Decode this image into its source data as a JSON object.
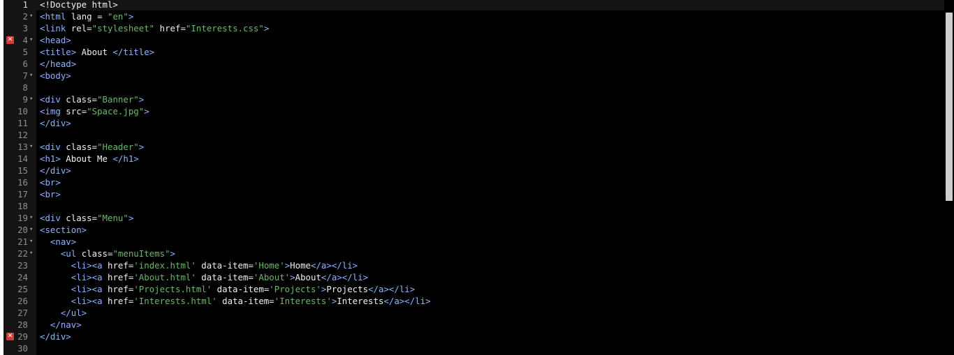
{
  "editor": {
    "colors": {
      "background": "#000000",
      "gutter": "#141414",
      "tag": "#8cb4ff",
      "string": "#68b868",
      "text": "#f0f0f0",
      "line_number": "#8f8f8f",
      "error_marker": "#d83a3a"
    },
    "lines": [
      {
        "n": "1",
        "fold": false,
        "error": false,
        "tokens": [
          {
            "t": "doctype",
            "v": "<!Doctype html>"
          }
        ]
      },
      {
        "n": "2",
        "fold": true,
        "error": false,
        "tokens": [
          {
            "t": "tag",
            "v": "<html"
          },
          {
            "t": "attr",
            "v": " lang "
          },
          {
            "t": "punc",
            "v": "= "
          },
          {
            "t": "str",
            "v": "\"en\""
          },
          {
            "t": "tag",
            "v": ">"
          }
        ]
      },
      {
        "n": "3",
        "fold": false,
        "error": false,
        "tokens": [
          {
            "t": "tag",
            "v": "<link"
          },
          {
            "t": "attr",
            "v": " rel"
          },
          {
            "t": "punc",
            "v": "="
          },
          {
            "t": "str",
            "v": "\"stylesheet\""
          },
          {
            "t": "attr",
            "v": " href"
          },
          {
            "t": "punc",
            "v": "="
          },
          {
            "t": "str",
            "v": "\"Interests.css\""
          },
          {
            "t": "tag",
            "v": ">"
          }
        ]
      },
      {
        "n": "4",
        "fold": true,
        "error": true,
        "tokens": [
          {
            "t": "tag",
            "v": "<head>"
          }
        ]
      },
      {
        "n": "5",
        "fold": false,
        "error": false,
        "tokens": [
          {
            "t": "tag",
            "v": "<title>"
          },
          {
            "t": "text",
            "v": " About "
          },
          {
            "t": "tag",
            "v": "</title>"
          }
        ]
      },
      {
        "n": "6",
        "fold": false,
        "error": false,
        "tokens": [
          {
            "t": "tag",
            "v": "</head>"
          }
        ]
      },
      {
        "n": "7",
        "fold": true,
        "error": false,
        "tokens": [
          {
            "t": "tag",
            "v": "<body>"
          }
        ]
      },
      {
        "n": "8",
        "fold": false,
        "error": false,
        "tokens": []
      },
      {
        "n": "9",
        "fold": true,
        "error": false,
        "tokens": [
          {
            "t": "tag",
            "v": "<div"
          },
          {
            "t": "attr",
            "v": " class"
          },
          {
            "t": "punc",
            "v": "="
          },
          {
            "t": "str",
            "v": "\"Banner\""
          },
          {
            "t": "tag",
            "v": ">"
          }
        ]
      },
      {
        "n": "10",
        "fold": false,
        "error": false,
        "tokens": [
          {
            "t": "tag",
            "v": "<img"
          },
          {
            "t": "attr",
            "v": " src"
          },
          {
            "t": "punc",
            "v": "="
          },
          {
            "t": "str",
            "v": "\"Space.jpg\""
          },
          {
            "t": "tag",
            "v": ">"
          }
        ]
      },
      {
        "n": "11",
        "fold": false,
        "error": false,
        "tokens": [
          {
            "t": "tag",
            "v": "</div>"
          }
        ]
      },
      {
        "n": "12",
        "fold": false,
        "error": false,
        "tokens": []
      },
      {
        "n": "13",
        "fold": true,
        "error": false,
        "tokens": [
          {
            "t": "tag",
            "v": "<div"
          },
          {
            "t": "attr",
            "v": " class"
          },
          {
            "t": "punc",
            "v": "="
          },
          {
            "t": "str",
            "v": "\"Header\""
          },
          {
            "t": "tag",
            "v": ">"
          }
        ]
      },
      {
        "n": "14",
        "fold": false,
        "error": false,
        "tokens": [
          {
            "t": "tag",
            "v": "<h1>"
          },
          {
            "t": "text",
            "v": " About Me "
          },
          {
            "t": "tag",
            "v": "</h1>"
          }
        ]
      },
      {
        "n": "15",
        "fold": false,
        "error": false,
        "tokens": [
          {
            "t": "tag",
            "v": "</div>"
          }
        ]
      },
      {
        "n": "16",
        "fold": false,
        "error": false,
        "tokens": [
          {
            "t": "tag",
            "v": "<br>"
          }
        ]
      },
      {
        "n": "17",
        "fold": false,
        "error": false,
        "tokens": [
          {
            "t": "tag",
            "v": "<br>"
          }
        ]
      },
      {
        "n": "18",
        "fold": false,
        "error": false,
        "tokens": []
      },
      {
        "n": "19",
        "fold": true,
        "error": false,
        "tokens": [
          {
            "t": "tag",
            "v": "<div"
          },
          {
            "t": "attr",
            "v": " class"
          },
          {
            "t": "punc",
            "v": "="
          },
          {
            "t": "str",
            "v": "\"Menu\""
          },
          {
            "t": "tag",
            "v": ">"
          }
        ]
      },
      {
        "n": "20",
        "fold": true,
        "error": false,
        "tokens": [
          {
            "t": "tag",
            "v": "<section>"
          }
        ]
      },
      {
        "n": "21",
        "fold": true,
        "error": false,
        "tokens": [
          {
            "t": "text",
            "v": "  "
          },
          {
            "t": "tag",
            "v": "<nav>"
          }
        ]
      },
      {
        "n": "22",
        "fold": true,
        "error": false,
        "tokens": [
          {
            "t": "text",
            "v": "    "
          },
          {
            "t": "tag",
            "v": "<ul"
          },
          {
            "t": "attr",
            "v": " class"
          },
          {
            "t": "punc",
            "v": "="
          },
          {
            "t": "str",
            "v": "\"menuItems\""
          },
          {
            "t": "tag",
            "v": ">"
          }
        ]
      },
      {
        "n": "23",
        "fold": false,
        "error": false,
        "tokens": [
          {
            "t": "text",
            "v": "      "
          },
          {
            "t": "tag",
            "v": "<li><a"
          },
          {
            "t": "attr",
            "v": " href"
          },
          {
            "t": "punc",
            "v": "="
          },
          {
            "t": "str",
            "v": "'index.html'"
          },
          {
            "t": "attr",
            "v": " data-item"
          },
          {
            "t": "punc",
            "v": "="
          },
          {
            "t": "str",
            "v": "'Home'"
          },
          {
            "t": "tag",
            "v": ">"
          },
          {
            "t": "text",
            "v": "Home"
          },
          {
            "t": "tag",
            "v": "</a></li>"
          }
        ]
      },
      {
        "n": "24",
        "fold": false,
        "error": false,
        "tokens": [
          {
            "t": "text",
            "v": "      "
          },
          {
            "t": "tag",
            "v": "<li><a"
          },
          {
            "t": "attr",
            "v": " href"
          },
          {
            "t": "punc",
            "v": "="
          },
          {
            "t": "str",
            "v": "'About.html'"
          },
          {
            "t": "attr",
            "v": " data-item"
          },
          {
            "t": "punc",
            "v": "="
          },
          {
            "t": "str",
            "v": "'About'"
          },
          {
            "t": "tag",
            "v": ">"
          },
          {
            "t": "text",
            "v": "About"
          },
          {
            "t": "tag",
            "v": "</a></li>"
          }
        ]
      },
      {
        "n": "25",
        "fold": false,
        "error": false,
        "tokens": [
          {
            "t": "text",
            "v": "      "
          },
          {
            "t": "tag",
            "v": "<li><a"
          },
          {
            "t": "attr",
            "v": " href"
          },
          {
            "t": "punc",
            "v": "="
          },
          {
            "t": "str",
            "v": "'Projects.html'"
          },
          {
            "t": "attr",
            "v": " data-item"
          },
          {
            "t": "punc",
            "v": "="
          },
          {
            "t": "str",
            "v": "'Projects'"
          },
          {
            "t": "tag",
            "v": ">"
          },
          {
            "t": "text",
            "v": "Projects"
          },
          {
            "t": "tag",
            "v": "</a></li>"
          }
        ]
      },
      {
        "n": "26",
        "fold": false,
        "error": false,
        "tokens": [
          {
            "t": "text",
            "v": "      "
          },
          {
            "t": "tag",
            "v": "<li><a"
          },
          {
            "t": "attr",
            "v": " href"
          },
          {
            "t": "punc",
            "v": "="
          },
          {
            "t": "str",
            "v": "'Interests.html'"
          },
          {
            "t": "attr",
            "v": " data-item"
          },
          {
            "t": "punc",
            "v": "="
          },
          {
            "t": "str",
            "v": "'Interests'"
          },
          {
            "t": "tag",
            "v": ">"
          },
          {
            "t": "text",
            "v": "Interests"
          },
          {
            "t": "tag",
            "v": "</a></li>"
          }
        ]
      },
      {
        "n": "27",
        "fold": false,
        "error": false,
        "tokens": [
          {
            "t": "text",
            "v": "    "
          },
          {
            "t": "tag",
            "v": "</ul>"
          }
        ]
      },
      {
        "n": "28",
        "fold": false,
        "error": false,
        "tokens": [
          {
            "t": "text",
            "v": "  "
          },
          {
            "t": "tag",
            "v": "</nav>"
          }
        ]
      },
      {
        "n": "29",
        "fold": false,
        "error": true,
        "tokens": [
          {
            "t": "tag",
            "v": "</div>"
          }
        ]
      },
      {
        "n": "30",
        "fold": false,
        "error": false,
        "tokens": []
      }
    ]
  }
}
